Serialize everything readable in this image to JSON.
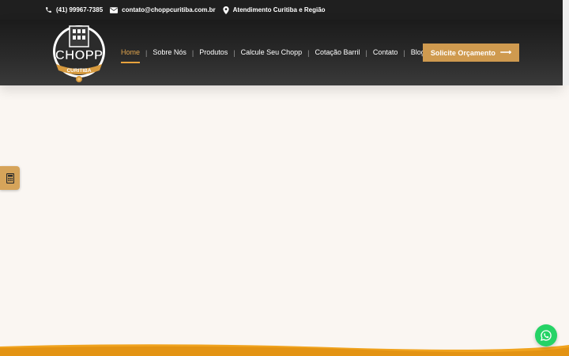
{
  "topbar": {
    "phone": "(41) 99967-7385",
    "email": "contato@choppcuritiba.com.br",
    "location": "Atendimento Curitiba e Região"
  },
  "logo": {
    "text_main": "CHOPP",
    "text_banner": "CURITIBA"
  },
  "nav": {
    "items": [
      {
        "label": "Home",
        "active": true
      },
      {
        "label": "Sobre Nós",
        "active": false
      },
      {
        "label": "Produtos",
        "active": false
      },
      {
        "label": "Calcule Seu Chopp",
        "active": false
      },
      {
        "label": "Cotação Barril",
        "active": false
      },
      {
        "label": "Contato",
        "active": false
      },
      {
        "label": "Blog",
        "active": false
      }
    ],
    "separator": "|"
  },
  "cta": {
    "label": "Solicite Orçamento",
    "arrow": "⟶"
  },
  "widgets": {
    "calculator_icon": "calculator-icon",
    "whatsapp_icon": "whatsapp-icon"
  },
  "colors": {
    "accent": "#cf9a4f",
    "active_nav": "#e2a64e",
    "header_dark": "#1f1f1f",
    "page_bg": "#faf6f2",
    "whatsapp": "#25d366",
    "band_orange": "#f0a31e"
  }
}
